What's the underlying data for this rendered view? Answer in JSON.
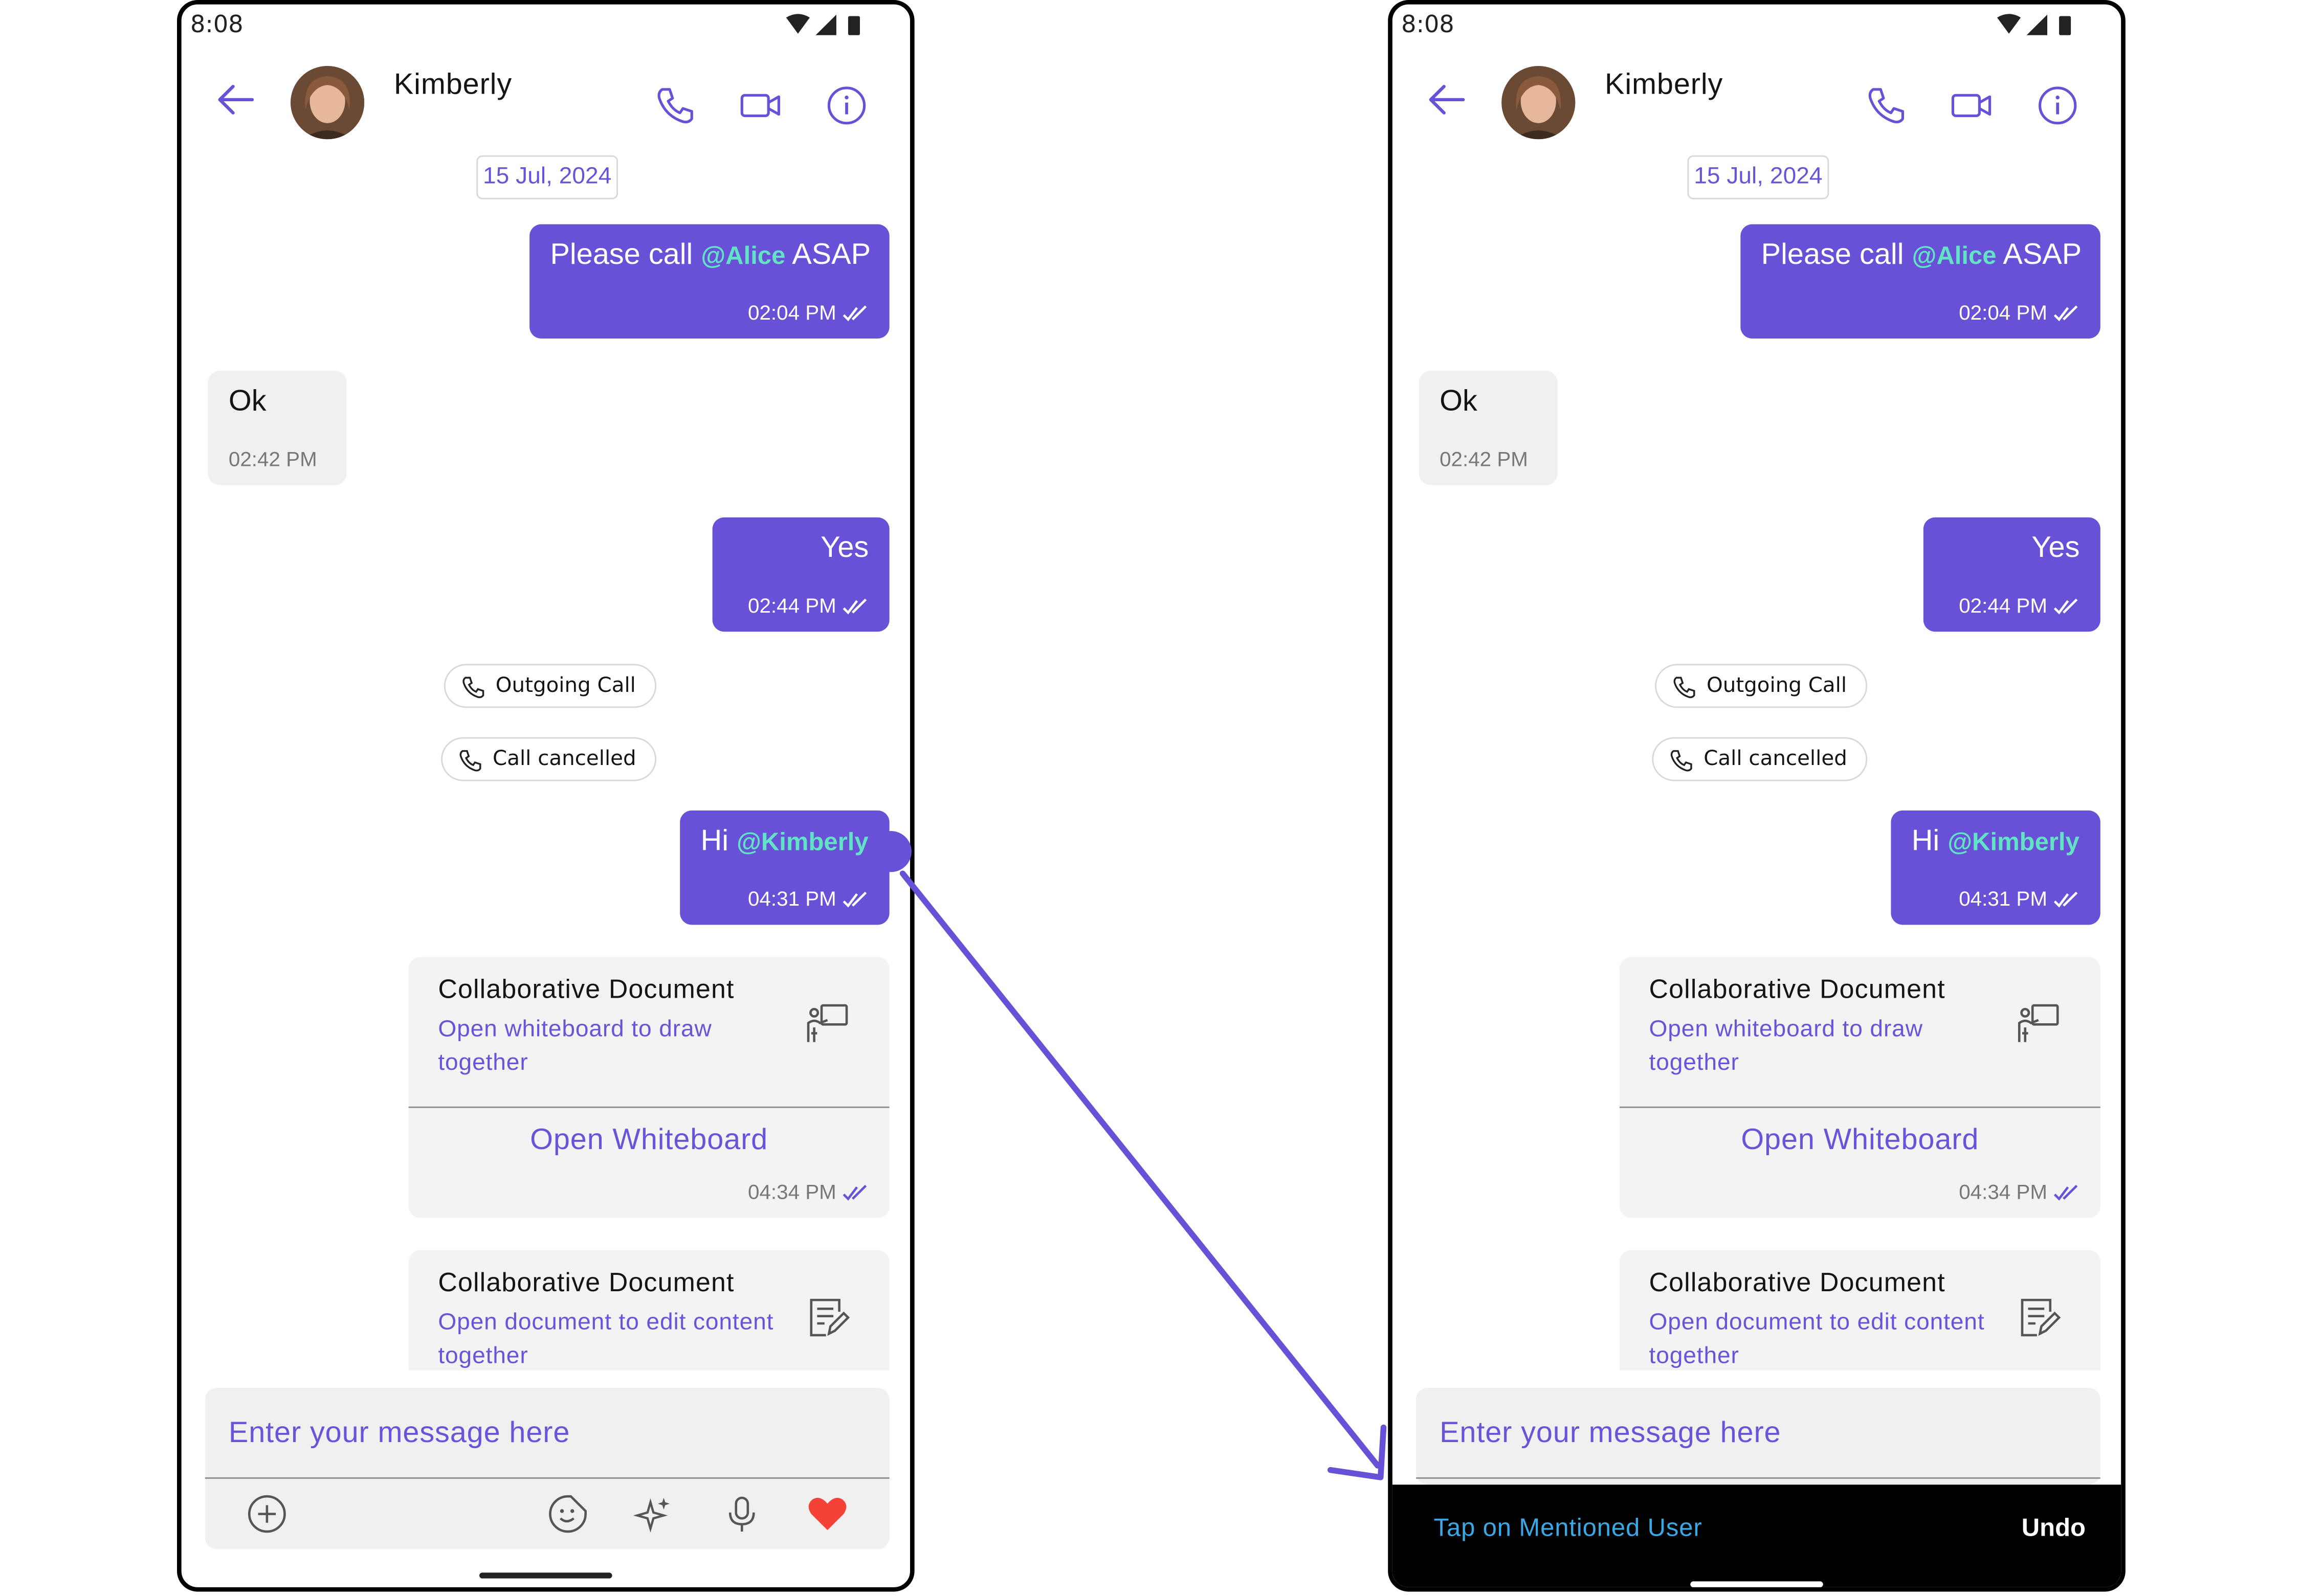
{
  "status": {
    "time": "8:08"
  },
  "header": {
    "name": "Kimberly"
  },
  "date_chip": "15 Jul, 2024",
  "messages": {
    "m1": {
      "text_before": "Please call ",
      "mention": "@Alice",
      "text_after": " ASAP",
      "time": "02:04 PM"
    },
    "m2": {
      "text": "Ok",
      "time": "02:42 PM"
    },
    "m3": {
      "text": "Yes",
      "time": "02:44 PM"
    },
    "call1": "Outgoing Call",
    "call2": "Call cancelled",
    "m4": {
      "text_before": "Hi ",
      "mention": "@Kimberly",
      "time": "04:31 PM"
    }
  },
  "cards": [
    {
      "title": "Collaborative Document",
      "subtitle": "Open whiteboard to draw together",
      "action": "Open Whiteboard",
      "time": "04:34 PM",
      "icon": "whiteboard-icon"
    },
    {
      "title": "Collaborative Document",
      "subtitle": "Open document to edit content together",
      "icon": "document-edit-icon"
    }
  ],
  "composer": {
    "placeholder": "Enter your message here"
  },
  "snackbar": {
    "text": "Tap on Mentioned User",
    "action": "Undo"
  },
  "colors": {
    "primary": "#6851d6",
    "mention": "#62e3c5",
    "snackbar_text": "#3aa8e4",
    "heart": "#f44336"
  }
}
